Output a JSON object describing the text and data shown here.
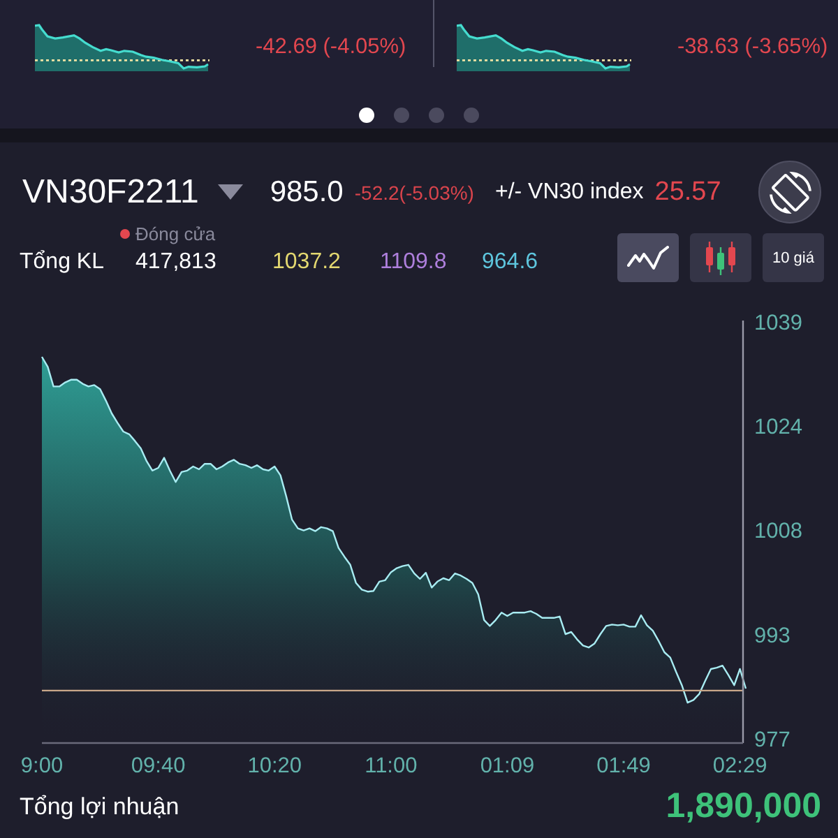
{
  "overview_cards": [
    {
      "change": "-42.69 (-4.05%)"
    },
    {
      "change": "-38.63 (-3.65%)"
    }
  ],
  "pager": [
    {
      "selected": true
    },
    {
      "selected": false
    },
    {
      "selected": false
    },
    {
      "selected": false
    }
  ],
  "quote": {
    "symbol": "VN30F2211",
    "price": "985.0",
    "change": "-52.2(-5.03%)",
    "basis_label": "+/- VN30 index",
    "basis": "25.57",
    "status": "Đóng cửa",
    "volume_label": "Tổng KL",
    "volume": "417,813",
    "prices": [
      {
        "value": "1037.2",
        "color": "#e3d870"
      },
      {
        "value": "1109.8",
        "color": "#ae7fdc"
      },
      {
        "value": "964.6",
        "color": "#5ec6de"
      }
    ]
  },
  "chart_modes": [
    {
      "kind": "line",
      "selected": true
    },
    {
      "kind": "candlestick",
      "selected": false
    },
    {
      "kind": "text",
      "label": "10 giá",
      "selected": false
    }
  ],
  "chart": {
    "chart_data": {
      "type": "area",
      "categories": [
        "9:00",
        null,
        null,
        null,
        null,
        null,
        null,
        null,
        null,
        null,
        null,
        null,
        null,
        null,
        null,
        null,
        null,
        null,
        null,
        null,
        "09:40",
        null,
        null,
        null,
        null,
        null,
        null,
        null,
        null,
        null,
        null,
        null,
        null,
        null,
        null,
        null,
        null,
        null,
        null,
        null,
        "10:20",
        null,
        null,
        null,
        null,
        null,
        null,
        null,
        null,
        null,
        null,
        null,
        null,
        null,
        null,
        null,
        null,
        null,
        null,
        null,
        "11:00",
        null,
        null,
        null,
        null,
        null,
        null,
        null,
        null,
        null,
        null,
        null,
        null,
        null,
        null,
        null,
        null,
        null,
        null,
        null,
        "01:09",
        null,
        null,
        null,
        null,
        null,
        null,
        null,
        null,
        null,
        null,
        null,
        null,
        null,
        null,
        null,
        null,
        null,
        null,
        null,
        "01:49",
        null,
        null,
        null,
        null,
        null,
        null,
        null,
        null,
        null,
        null,
        null,
        null,
        null,
        null,
        null,
        null,
        null,
        null,
        null,
        "02:29",
        null
      ],
      "ylim": [
        976.4,
        1039.2
      ],
      "yticks": [
        977,
        {
          "value": 992.5,
          "label": "993"
        },
        1008,
        {
          "value": 1023.5,
          "label": "1024"
        },
        1039
      ],
      "series": [
        {
          "color": "#a8ecf2",
          "values": [
            1033.8,
            1032.3,
            1029.4,
            1029.4,
            1030.0,
            1030.4,
            1030.4,
            1029.8,
            1029.4,
            1029.6,
            1029.0,
            1027.3,
            1025.4,
            1024.0,
            1022.7,
            1022.3,
            1021.3,
            1020.2,
            1018.3,
            1016.9,
            1017.3,
            1018.8,
            1016.9,
            1015.2,
            1016.7,
            1016.9,
            1017.5,
            1017.1,
            1017.9,
            1017.9,
            1017.1,
            1017.5,
            1018.1,
            1018.5,
            1017.9,
            1017.7,
            1017.3,
            1017.7,
            1017.1,
            1016.9,
            1017.5,
            1016.2,
            1013.1,
            1009.6,
            1008.3,
            1008.0,
            1008.3,
            1007.9,
            1008.5,
            1008.3,
            1007.9,
            1005.4,
            1004.1,
            1002.9,
            1000.2,
            999.2,
            998.9,
            999.0,
            1000.4,
            1000.6,
            1001.8,
            1002.4,
            1002.7,
            1002.9,
            1001.6,
            1000.8,
            1001.7,
            999.5,
            1000.4,
            1000.9,
            1000.6,
            1001.6,
            1001.3,
            1000.8,
            1000.2,
            998.5,
            994.7,
            993.8,
            994.7,
            995.8,
            995.3,
            995.8,
            995.8,
            995.8,
            996.0,
            995.6,
            995.0,
            995.0,
            995.0,
            995.2,
            992.6,
            992.9,
            991.8,
            990.9,
            990.6,
            991.2,
            992.6,
            993.8,
            994.0,
            993.9,
            994.0,
            993.7,
            993.7,
            995.4,
            993.9,
            993.1,
            991.6,
            989.9,
            989.1,
            987.0,
            985.0,
            982.4,
            982.8,
            983.7,
            985.6,
            987.4,
            987.6,
            987.9,
            986.5,
            985.0,
            987.4,
            984.5
          ]
        }
      ],
      "ref_lines": [
        {
          "axis": "y",
          "value": 984.2,
          "color": "#c9a88a"
        }
      ]
    }
  },
  "profit": {
    "label": "Tổng lợi nhuận",
    "value": "1,890,000"
  }
}
